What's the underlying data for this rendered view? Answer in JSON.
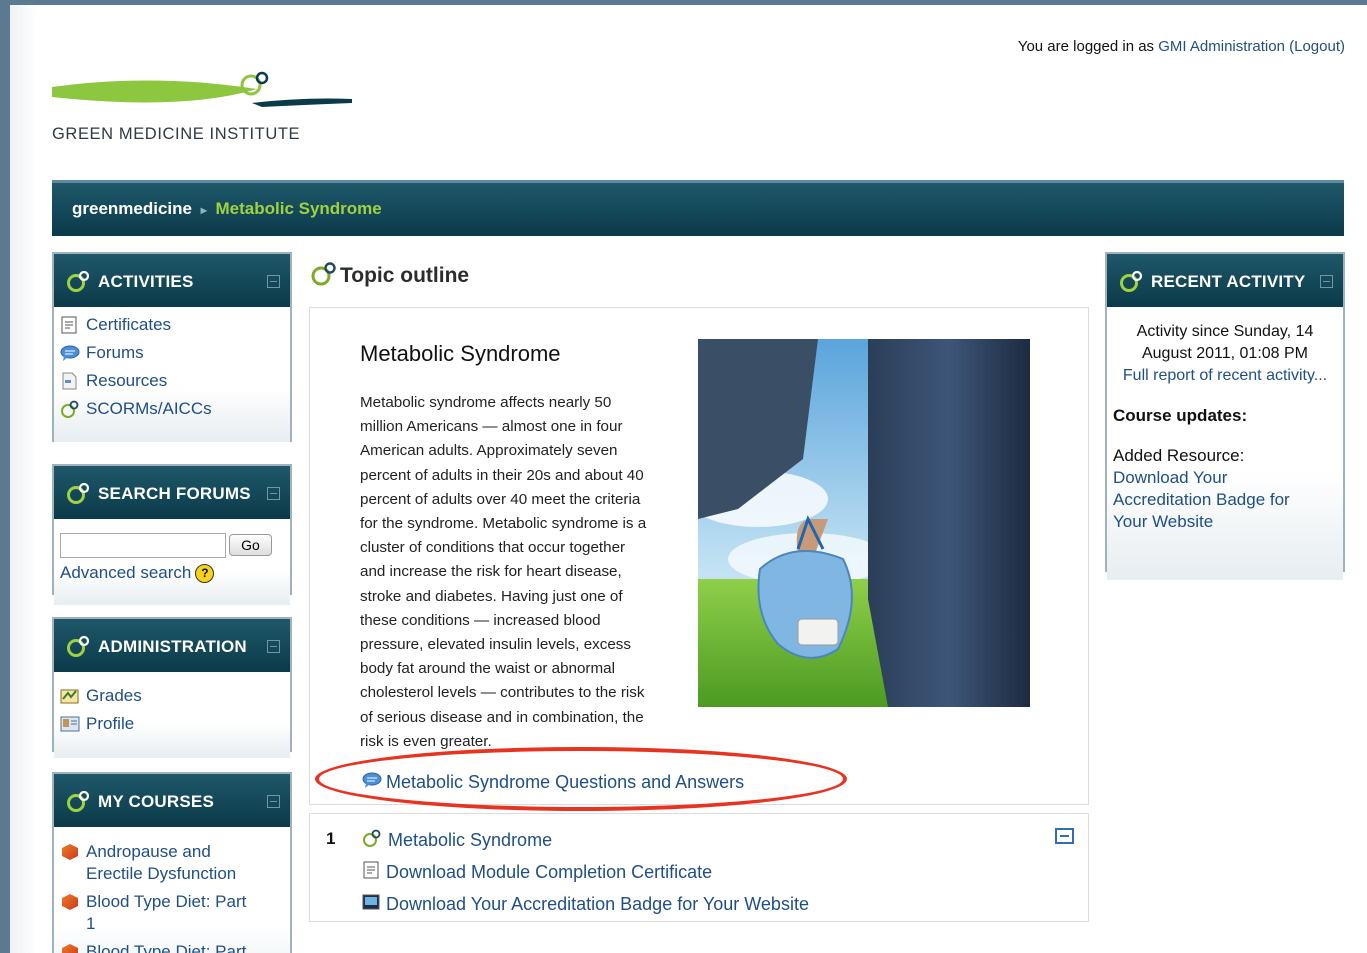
{
  "login": {
    "prefix": "You are logged in as",
    "user": "GMI Administration",
    "logout": "(Logout)"
  },
  "logo": {
    "text": "GREEN MEDICINE INSTITUTE"
  },
  "breadcrumb": {
    "home": "greenmedicine",
    "separator": "▸",
    "current": "Metabolic Syndrome"
  },
  "activities": {
    "title": "ACTIVITIES",
    "items": [
      {
        "label": "Certificates",
        "icon": "certificate-icon"
      },
      {
        "label": "Forums",
        "icon": "forum-icon"
      },
      {
        "label": "Resources",
        "icon": "resource-icon"
      },
      {
        "label": "SCORMs/AICCs",
        "icon": "scorm-icon"
      }
    ]
  },
  "search_forums": {
    "title": "SEARCH FORUMS",
    "go": "Go",
    "advanced": "Advanced search",
    "value": ""
  },
  "administration": {
    "title": "ADMINISTRATION",
    "items": [
      {
        "label": "Grades",
        "icon": "grades-icon"
      },
      {
        "label": "Profile",
        "icon": "profile-icon"
      }
    ]
  },
  "my_courses": {
    "title": "MY COURSES",
    "items": [
      {
        "line1": "Andropause and",
        "line2": "Erectile Dysfunction"
      },
      {
        "line1": "Blood Type Diet: Part",
        "line2": "1"
      },
      {
        "line1": "Blood Type Diet: Part",
        "line2": ""
      }
    ]
  },
  "main": {
    "topic_title": "Topic outline",
    "section_title": "Metabolic Syndrome",
    "description": [
      "Metabolic syndrome affects nearly 50",
      "million Americans — almost one in four",
      "American adults. Approximately seven",
      "percent of adults in their 20s and about 40",
      "percent of adults over 40 meet the criteria",
      "for the syndrome. Metabolic syndrome is a",
      "cluster of conditions that occur together",
      "and increase the risk for heart disease,",
      "stroke and diabetes. Having just one of",
      "these conditions — increased blood",
      "pressure, elevated insulin levels, excess",
      "body fat around the waist or abnormal",
      "cholesterol levels — contributes to the risk",
      "of serious disease and in combination, the",
      "risk is even greater."
    ],
    "qa_link": "Metabolic Syndrome Questions and Answers"
  },
  "section1": {
    "number": "1",
    "items": [
      {
        "label": "Metabolic Syndrome",
        "icon": "scorm-icon"
      },
      {
        "label": "Download Module Completion Certificate",
        "icon": "certificate-icon"
      },
      {
        "label": "Download Your Accreditation Badge for Your Website",
        "icon": "image-icon"
      }
    ]
  },
  "recent": {
    "title": "RECENT ACTIVITY",
    "since_line1": "Activity since Sunday, 14",
    "since_line2": "August 2011, 01:08 PM",
    "full_report": "Full report of recent activity...",
    "updates_title": "Course updates:",
    "added": "Added Resource:",
    "link_line1": "Download Your",
    "link_line2": "Accreditation Badge for",
    "link_line3": "Your Website"
  },
  "colors": {
    "header_dark": "#0b3a4a",
    "accent_green": "#9fd23f",
    "link_blue": "#1f4f86",
    "highlight_red": "#e83321"
  }
}
